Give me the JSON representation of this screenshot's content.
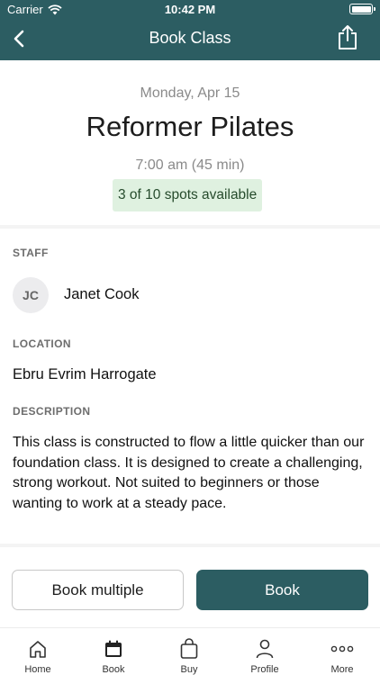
{
  "status_bar": {
    "carrier": "Carrier",
    "time": "10:42 PM"
  },
  "header": {
    "title": "Book Class"
  },
  "class_info": {
    "date": "Monday, Apr 15",
    "name": "Reformer Pilates",
    "time": "7:00 am (45 min)",
    "spots": "3 of 10 spots available"
  },
  "staff": {
    "label": "STAFF",
    "initials": "JC",
    "name": "Janet Cook"
  },
  "location": {
    "label": "LOCATION",
    "name": "Ebru Evrim Harrogate"
  },
  "description": {
    "label": "DESCRIPTION",
    "text": "This class is constructed to flow a little quicker than our foundation class. It is designed to create a challenging, strong workout. Not suited to beginners or those wanting to work at a steady pace."
  },
  "actions": {
    "book_multiple": "Book multiple",
    "book": "Book"
  },
  "tabs": [
    {
      "label": "Home",
      "icon": "home-icon"
    },
    {
      "label": "Book",
      "icon": "calendar-icon"
    },
    {
      "label": "Buy",
      "icon": "shopping-bag-icon"
    },
    {
      "label": "Profile",
      "icon": "person-icon"
    },
    {
      "label": "More",
      "icon": "more-icon"
    }
  ],
  "colors": {
    "brand": "#2c5d62",
    "spots_bg": "#dff1e0"
  }
}
